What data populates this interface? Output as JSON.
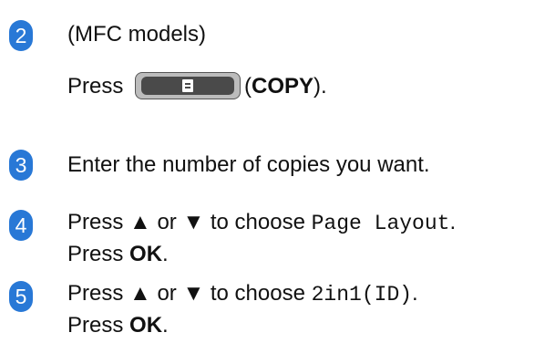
{
  "steps": [
    {
      "number": "2",
      "line1": "(MFC models)",
      "line2_prefix": "Press",
      "button_icon": "copy-icon",
      "line2_open": "(",
      "line2_bold": "COPY",
      "line2_close": ")."
    },
    {
      "number": "3",
      "line1": "Enter the number of copies you want."
    },
    {
      "number": "4",
      "line1_prefix": "Press ▲ or ▼ to choose",
      "line1_mono": "Page Layout",
      "line1_end": ".",
      "line2_prefix": "Press",
      "line2_bold": "OK",
      "line2_end": "."
    },
    {
      "number": "5",
      "line1_prefix": "Press ▲ or ▼ to choose",
      "line1_mono": "2in1(ID)",
      "line1_end": ".",
      "line2_prefix": "Press",
      "line2_bold": "OK",
      "line2_end": "."
    }
  ],
  "colors": {
    "badge": "#2878d6",
    "text": "#111111"
  }
}
